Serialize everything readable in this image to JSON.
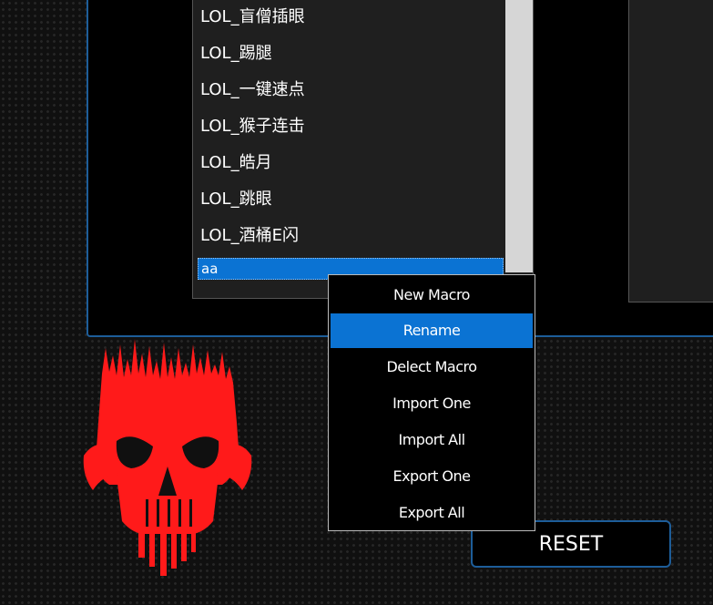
{
  "macro_list": {
    "items": [
      {
        "label": "LOL_盲僧插眼"
      },
      {
        "label": "LOL_踢腿"
      },
      {
        "label": "LOL_一键速点"
      },
      {
        "label": "LOL_猴子连击"
      },
      {
        "label": "LOL_皓月"
      },
      {
        "label": "LOL_跳眼"
      },
      {
        "label": "LOL_酒桶E闪"
      },
      {
        "label": "aa",
        "selected": true
      }
    ]
  },
  "context_menu": {
    "items": [
      {
        "label": "New Macro"
      },
      {
        "label": "Rename",
        "highlighted": true
      },
      {
        "label": "Delect Macro"
      },
      {
        "label": "Import One"
      },
      {
        "label": "Import All"
      },
      {
        "label": "Export One"
      },
      {
        "label": "Export All"
      }
    ]
  },
  "reset_label": "RESET",
  "colors": {
    "accent": "#0b73d3",
    "panel_border": "#1d5d99",
    "logo": "#ff1a1a"
  },
  "icons": {
    "logo": "red-skull-logo"
  }
}
